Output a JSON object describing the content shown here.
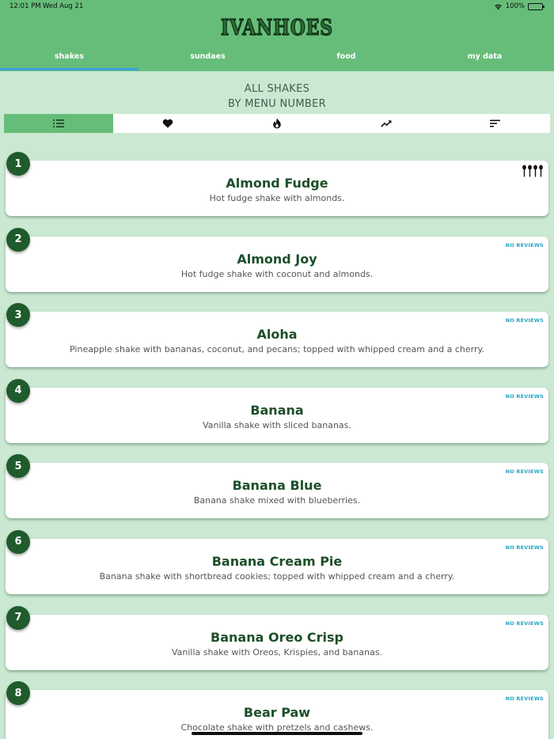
{
  "status_bar": {
    "time": "12:01 PM",
    "date": "Wed Aug 21",
    "battery": "100%"
  },
  "header": {
    "logo": "IVANHOES",
    "tabs": [
      {
        "label": "shakes",
        "active": true
      },
      {
        "label": "sundaes",
        "active": false
      },
      {
        "label": "food",
        "active": false
      },
      {
        "label": "my data",
        "active": false
      }
    ]
  },
  "subtitle": {
    "line1": "ALL SHAKES",
    "line2": "BY MENU NUMBER"
  },
  "sort_options": [
    {
      "icon": "list-numbered-icon",
      "active": true
    },
    {
      "icon": "heart-icon",
      "active": false
    },
    {
      "icon": "flame-icon",
      "active": false
    },
    {
      "icon": "trending-up-icon",
      "active": false
    },
    {
      "icon": "sort-icon",
      "active": false
    }
  ],
  "reviews_placeholder": "NO REVIEWS",
  "items": [
    {
      "number": "1",
      "name": "Almond Fudge",
      "description": "Hot fudge shake with almonds.",
      "rating_icon": "spoons-icon",
      "rating": 4
    },
    {
      "number": "2",
      "name": "Almond Joy",
      "description": "Hot fudge shake with coconut and almonds.",
      "reviews": "NO REVIEWS"
    },
    {
      "number": "3",
      "name": "Aloha",
      "description": "Pineapple shake with bananas, coconut, and pecans; topped with whipped cream and a cherry.",
      "reviews": "NO REVIEWS"
    },
    {
      "number": "4",
      "name": "Banana",
      "description": "Vanilla shake with sliced bananas.",
      "reviews": "NO REVIEWS"
    },
    {
      "number": "5",
      "name": "Banana Blue",
      "description": "Banana shake mixed with blueberries.",
      "reviews": "NO REVIEWS"
    },
    {
      "number": "6",
      "name": "Banana Cream Pie",
      "description": "Banana shake with shortbread cookies; topped with whipped cream and a cherry.",
      "reviews": "NO REVIEWS"
    },
    {
      "number": "7",
      "name": "Banana Oreo Crisp",
      "description": "Vanilla shake with Oreos, Krispies, and bananas.",
      "reviews": "NO REVIEWS"
    },
    {
      "number": "8",
      "name": "Bear Paw",
      "description": "Chocolate shake with pretzels and cashews.",
      "reviews": "NO REVIEWS"
    }
  ],
  "colors": {
    "header": "#66bd79",
    "background": "#cae8d2",
    "badge": "#1f5b2c",
    "accent": "#3aa1e0",
    "reviews": "#27a3c4",
    "title": "#1d4f2a"
  }
}
